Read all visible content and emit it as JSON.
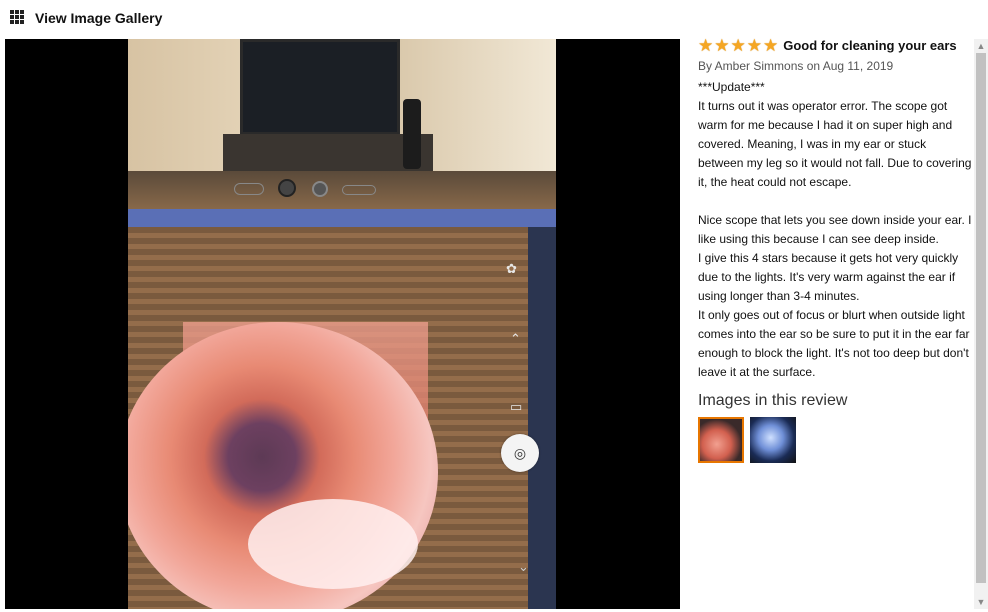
{
  "header": {
    "title": "View Image Gallery",
    "icon": "grid-icon"
  },
  "viewer": {
    "camera_button_icon": "camera-icon"
  },
  "review": {
    "stars": 5,
    "title": "Good for cleaning your ears",
    "author_line": "By Amber Simmons on Aug 11, 2019",
    "paragraphs": [
      "***Update***",
      "It turns out it was operator error. The scope got warm for me because I had it on super high and covered. Meaning, I was in my ear or stuck between my leg so it would not fall. Due to covering it, the heat could not escape.",
      "",
      "Nice scope that lets you see down inside your ear. I like using this because I can see deep inside.",
      "I give this 4 stars because it gets hot very quickly due to the lights. It's very warm against the ear if using longer than 3-4 minutes.",
      "It only goes out of focus or blurt when outside light comes into the ear so be sure to put it in the ear far enough to block the light. It's not too deep but don't leave it at the surface."
    ],
    "images_heading": "Images in this review",
    "accent_color": "#e77600",
    "star_color": "#f5a623"
  }
}
